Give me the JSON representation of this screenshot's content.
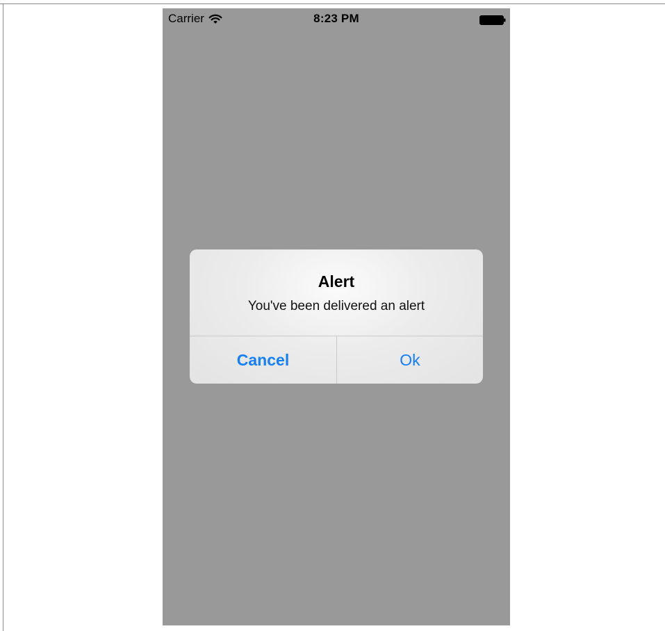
{
  "status_bar": {
    "carrier": "Carrier",
    "time": "8:23 PM",
    "wifi_icon": "wifi-icon",
    "battery_icon": "battery-icon"
  },
  "alert": {
    "title": "Alert",
    "message": "You've been delivered an alert",
    "buttons": {
      "cancel_label": "Cancel",
      "ok_label": "Ok"
    }
  },
  "colors": {
    "screen_background": "#999999",
    "alert_background": "#ececec",
    "button_tint": "#147efb",
    "divider": "#c9c9c9"
  }
}
